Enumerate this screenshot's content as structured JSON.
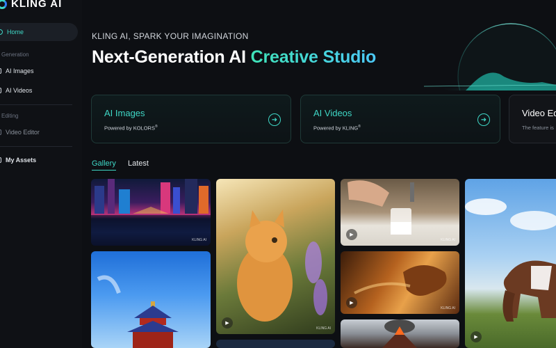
{
  "app": {
    "logo_text": "KLING AI"
  },
  "sidebar": {
    "home": "Home",
    "generation_label": "Generation",
    "ai_images": "AI Images",
    "ai_videos": "AI Videos",
    "editing_label": "Editing",
    "video_editor": "Video Editor",
    "my_assets": "My Assets"
  },
  "hero": {
    "subtitle": "KLING AI, SPARK YOUR IMAGINATION",
    "title_main": "Next-Generation AI ",
    "title_accent": "Creative Studio"
  },
  "cards": [
    {
      "title": "AI Images",
      "sub": "Powered by KOLORS",
      "sup": "®"
    },
    {
      "title": "AI Videos",
      "sub": "Powered by KLING",
      "sup": "®"
    },
    {
      "title": "Video Ed",
      "sub": "The feature is"
    }
  ],
  "tabs": {
    "gallery": "Gallery",
    "latest": "Latest"
  },
  "gallery": {
    "watermark": "KLING AI"
  },
  "colors": {
    "accent": "#3fd7c6",
    "background": "#0d0f13"
  }
}
